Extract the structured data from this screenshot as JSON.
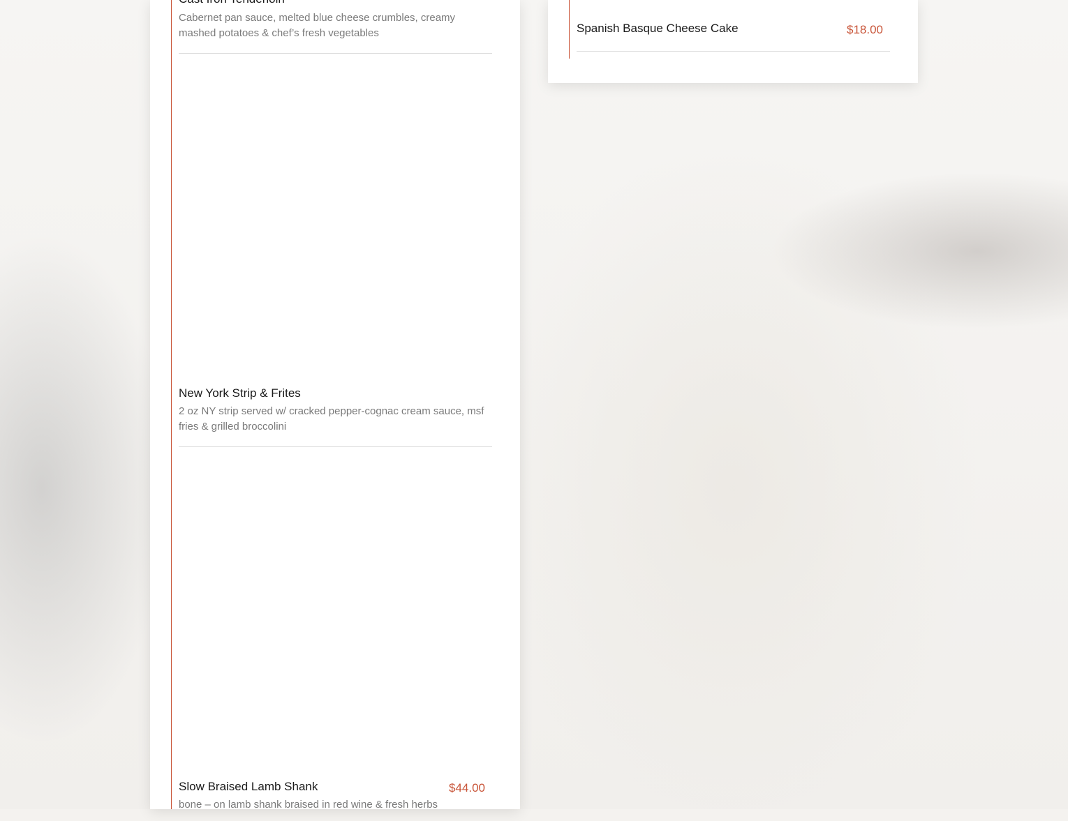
{
  "menu": {
    "left_column": {
      "items": [
        {
          "name": "Cast Iron Tenderloin",
          "description": "Cabernet pan sauce, melted blue cheese crumbles, creamy mashed potatoes & chef’s fresh vegetables",
          "price": ""
        },
        {
          "name": "New York Strip & Frites",
          "description": "2 oz NY strip served w/ cracked pepper-cognac cream sauce, msf fries & grilled broccolini",
          "price": ""
        },
        {
          "name": "Slow Braised Lamb Shank",
          "description": "bone – on lamb shank braised in red wine & fresh herbs",
          "price": "$44.00"
        }
      ]
    },
    "right_column": {
      "items": [
        {
          "name": "Spanish Basque Cheese Cake",
          "price": "$18.00"
        }
      ]
    }
  },
  "colors": {
    "accent": "#c9563a",
    "text_primary": "#1a1a1a",
    "text_secondary": "#7a7a7a",
    "card_background": "#ffffff",
    "page_background": "#f4f2ef"
  }
}
